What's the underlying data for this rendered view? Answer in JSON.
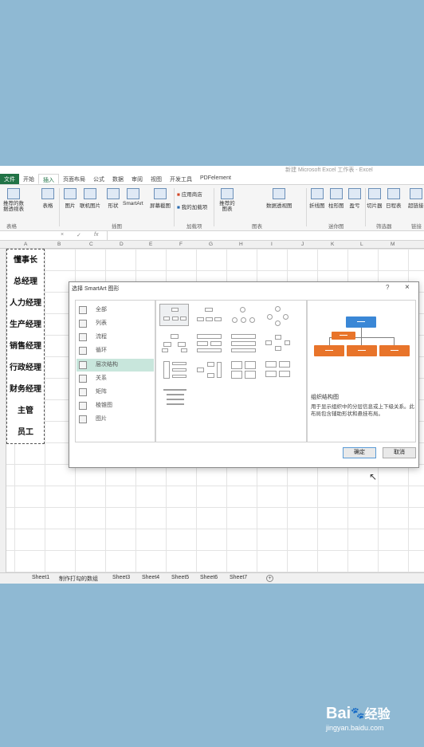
{
  "excel": {
    "doc_title": "新建 Microsoft Excel 工作表 - Excel",
    "tabs": [
      "文件",
      "开始",
      "插入",
      "页面布局",
      "公式",
      "数据",
      "审阅",
      "视图",
      "开发工具",
      "PDFelement"
    ],
    "ribbon": {
      "buttons": [
        "推荐的数据透视表",
        "表格",
        "图片",
        "联机图片",
        "形状",
        "SmartArt",
        "屏幕截图",
        "应用商店",
        "我的加载项",
        "推荐的图表",
        "数据透视图",
        "折线图",
        "柱形图",
        "盈亏",
        "切片器",
        "日程表",
        "超链接"
      ],
      "groups": [
        "表格",
        "插图",
        "加载项",
        "图表",
        "迷你图",
        "筛选器",
        "链接"
      ]
    },
    "formula_bar": {
      "fx": "fx",
      "cancel": "×",
      "enter": "✓"
    },
    "columns": [
      "A",
      "B",
      "C",
      "D",
      "E",
      "F",
      "G",
      "H",
      "I",
      "J",
      "K",
      "L",
      "M"
    ],
    "cells": [
      "懂事长",
      "总经理",
      "人力经理",
      "生产经理",
      "销售经理",
      "行政经理",
      "财务经理",
      "主管",
      "员工"
    ],
    "sheet_tabs": [
      "Sheet1",
      "制作打勾的数组",
      "Sheet3",
      "Sheet4",
      "Sheet5",
      "Sheet6",
      "Sheet7"
    ],
    "add_sheet": "+"
  },
  "dialog": {
    "title": "选择 SmartArt 图形",
    "help": "?",
    "close": "×",
    "categories": [
      "全部",
      "列表",
      "流程",
      "循环",
      "层次结构",
      "关系",
      "矩阵",
      "棱锥图",
      "图片"
    ],
    "selected_category": "层次结构",
    "preview_title": "组织结构图",
    "preview_desc": "用于显示组织中的分层信息或上下级关系。此布局包含辅助形状和悬挂布局。",
    "ok": "确定",
    "cancel": "取消"
  },
  "watermark": {
    "brand": "Bai",
    "paw": "🐾",
    "brand2": "经验",
    "url": "jingyan.baidu.com"
  },
  "colors": {
    "excel_green": "#217346",
    "selected_category": "#c8e6dc",
    "org_top": "#3a87d6",
    "org_child": "#e8742a"
  }
}
